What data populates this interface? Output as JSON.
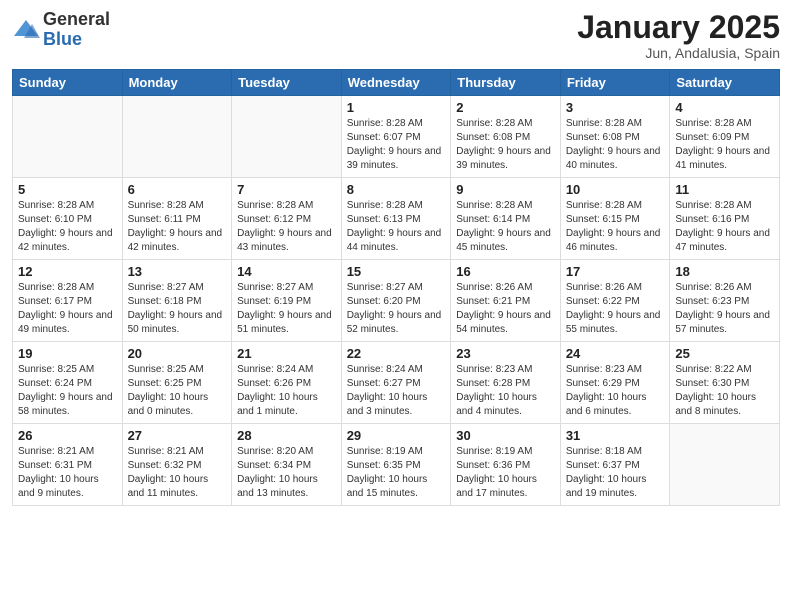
{
  "logo": {
    "general": "General",
    "blue": "Blue"
  },
  "header": {
    "month": "January 2025",
    "location": "Jun, Andalusia, Spain"
  },
  "weekdays": [
    "Sunday",
    "Monday",
    "Tuesday",
    "Wednesday",
    "Thursday",
    "Friday",
    "Saturday"
  ],
  "weeks": [
    [
      {
        "day": "",
        "info": ""
      },
      {
        "day": "",
        "info": ""
      },
      {
        "day": "",
        "info": ""
      },
      {
        "day": "1",
        "info": "Sunrise: 8:28 AM\nSunset: 6:07 PM\nDaylight: 9 hours and 39 minutes."
      },
      {
        "day": "2",
        "info": "Sunrise: 8:28 AM\nSunset: 6:08 PM\nDaylight: 9 hours and 39 minutes."
      },
      {
        "day": "3",
        "info": "Sunrise: 8:28 AM\nSunset: 6:08 PM\nDaylight: 9 hours and 40 minutes."
      },
      {
        "day": "4",
        "info": "Sunrise: 8:28 AM\nSunset: 6:09 PM\nDaylight: 9 hours and 41 minutes."
      }
    ],
    [
      {
        "day": "5",
        "info": "Sunrise: 8:28 AM\nSunset: 6:10 PM\nDaylight: 9 hours and 42 minutes."
      },
      {
        "day": "6",
        "info": "Sunrise: 8:28 AM\nSunset: 6:11 PM\nDaylight: 9 hours and 42 minutes."
      },
      {
        "day": "7",
        "info": "Sunrise: 8:28 AM\nSunset: 6:12 PM\nDaylight: 9 hours and 43 minutes."
      },
      {
        "day": "8",
        "info": "Sunrise: 8:28 AM\nSunset: 6:13 PM\nDaylight: 9 hours and 44 minutes."
      },
      {
        "day": "9",
        "info": "Sunrise: 8:28 AM\nSunset: 6:14 PM\nDaylight: 9 hours and 45 minutes."
      },
      {
        "day": "10",
        "info": "Sunrise: 8:28 AM\nSunset: 6:15 PM\nDaylight: 9 hours and 46 minutes."
      },
      {
        "day": "11",
        "info": "Sunrise: 8:28 AM\nSunset: 6:16 PM\nDaylight: 9 hours and 47 minutes."
      }
    ],
    [
      {
        "day": "12",
        "info": "Sunrise: 8:28 AM\nSunset: 6:17 PM\nDaylight: 9 hours and 49 minutes."
      },
      {
        "day": "13",
        "info": "Sunrise: 8:27 AM\nSunset: 6:18 PM\nDaylight: 9 hours and 50 minutes."
      },
      {
        "day": "14",
        "info": "Sunrise: 8:27 AM\nSunset: 6:19 PM\nDaylight: 9 hours and 51 minutes."
      },
      {
        "day": "15",
        "info": "Sunrise: 8:27 AM\nSunset: 6:20 PM\nDaylight: 9 hours and 52 minutes."
      },
      {
        "day": "16",
        "info": "Sunrise: 8:26 AM\nSunset: 6:21 PM\nDaylight: 9 hours and 54 minutes."
      },
      {
        "day": "17",
        "info": "Sunrise: 8:26 AM\nSunset: 6:22 PM\nDaylight: 9 hours and 55 minutes."
      },
      {
        "day": "18",
        "info": "Sunrise: 8:26 AM\nSunset: 6:23 PM\nDaylight: 9 hours and 57 minutes."
      }
    ],
    [
      {
        "day": "19",
        "info": "Sunrise: 8:25 AM\nSunset: 6:24 PM\nDaylight: 9 hours and 58 minutes."
      },
      {
        "day": "20",
        "info": "Sunrise: 8:25 AM\nSunset: 6:25 PM\nDaylight: 10 hours and 0 minutes."
      },
      {
        "day": "21",
        "info": "Sunrise: 8:24 AM\nSunset: 6:26 PM\nDaylight: 10 hours and 1 minute."
      },
      {
        "day": "22",
        "info": "Sunrise: 8:24 AM\nSunset: 6:27 PM\nDaylight: 10 hours and 3 minutes."
      },
      {
        "day": "23",
        "info": "Sunrise: 8:23 AM\nSunset: 6:28 PM\nDaylight: 10 hours and 4 minutes."
      },
      {
        "day": "24",
        "info": "Sunrise: 8:23 AM\nSunset: 6:29 PM\nDaylight: 10 hours and 6 minutes."
      },
      {
        "day": "25",
        "info": "Sunrise: 8:22 AM\nSunset: 6:30 PM\nDaylight: 10 hours and 8 minutes."
      }
    ],
    [
      {
        "day": "26",
        "info": "Sunrise: 8:21 AM\nSunset: 6:31 PM\nDaylight: 10 hours and 9 minutes."
      },
      {
        "day": "27",
        "info": "Sunrise: 8:21 AM\nSunset: 6:32 PM\nDaylight: 10 hours and 11 minutes."
      },
      {
        "day": "28",
        "info": "Sunrise: 8:20 AM\nSunset: 6:34 PM\nDaylight: 10 hours and 13 minutes."
      },
      {
        "day": "29",
        "info": "Sunrise: 8:19 AM\nSunset: 6:35 PM\nDaylight: 10 hours and 15 minutes."
      },
      {
        "day": "30",
        "info": "Sunrise: 8:19 AM\nSunset: 6:36 PM\nDaylight: 10 hours and 17 minutes."
      },
      {
        "day": "31",
        "info": "Sunrise: 8:18 AM\nSunset: 6:37 PM\nDaylight: 10 hours and 19 minutes."
      },
      {
        "day": "",
        "info": ""
      }
    ]
  ]
}
